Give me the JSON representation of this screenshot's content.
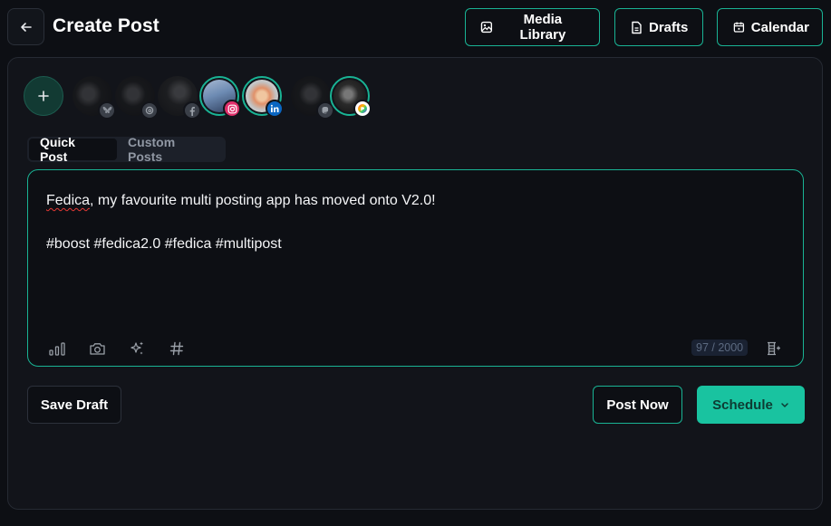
{
  "header": {
    "back_icon": "arrow-left-icon",
    "title": "Create Post",
    "buttons": [
      {
        "label": "Media Library",
        "icon": "image-icon"
      },
      {
        "label": "Drafts",
        "icon": "document-icon"
      },
      {
        "label": "Calendar",
        "icon": "calendar-icon"
      }
    ]
  },
  "accounts": {
    "add_icon": "plus-icon",
    "items": [
      {
        "network": "bluesky",
        "selected": false,
        "badge_color": "#3a3f48"
      },
      {
        "network": "threads",
        "selected": false,
        "badge_color": "#3a3f48"
      },
      {
        "network": "facebook",
        "selected": false,
        "badge_color": "#3a3f48"
      },
      {
        "network": "instagram",
        "selected": true,
        "badge_color": "#e1306c"
      },
      {
        "network": "linkedin",
        "selected": true,
        "badge_color": "#0a66c2"
      },
      {
        "network": "mastodon",
        "selected": false,
        "badge_color": "#3a3f48"
      },
      {
        "network": "pixelfed",
        "selected": true,
        "badge_color": "#ffffff"
      }
    ]
  },
  "tabs": [
    {
      "label": "Quick Post",
      "active": true
    },
    {
      "label": "Custom Posts",
      "active": false
    }
  ],
  "editor": {
    "line1_word": "Fedica",
    "line1_rest": ", my favourite multi posting app has moved onto V2.0!",
    "line2": "#boost #fedica2.0 #fedica #multipost",
    "char_count": "97 / 2000",
    "toolbar_icons": [
      "chart-icon",
      "camera-icon",
      "sparkles-icon",
      "hashtag-icon"
    ],
    "thread_icon": "thread-add-icon"
  },
  "actions": {
    "save_draft": "Save Draft",
    "post_now": "Post Now",
    "schedule": "Schedule"
  },
  "colors": {
    "accent": "#19b394",
    "background": "#0d0f14",
    "panel": "#12141a"
  }
}
